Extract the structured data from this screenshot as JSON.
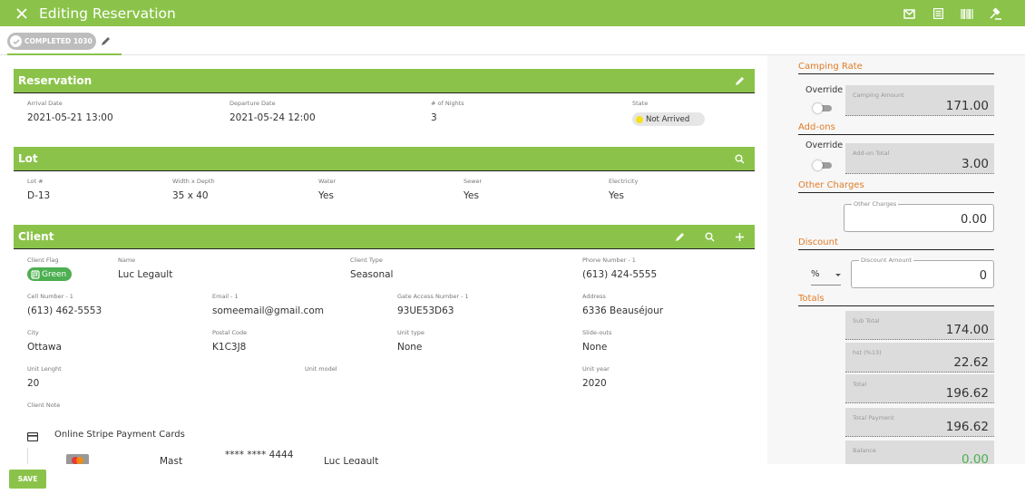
{
  "header": {
    "title": "Editing Reservation"
  },
  "status": {
    "chip": "COMPLETED 1030"
  },
  "reservation": {
    "title": "Reservation",
    "arrival_label": "Arrival Date",
    "arrival": "2021-05-21 13:00",
    "departure_label": "Departure Date",
    "departure": "2021-05-24 12:00",
    "nights_label": "# of Nights",
    "nights": "3",
    "state_label": "State",
    "state": "Not Arrived"
  },
  "lot": {
    "title": "Lot",
    "lot_label": "Lot #",
    "lot": "D-13",
    "size_label": "Width x Depth",
    "size": "35 x 40",
    "water_label": "Water",
    "water": "Yes",
    "sewer_label": "Sewer",
    "sewer": "Yes",
    "elec_label": "Electricity",
    "elec": "Yes"
  },
  "client": {
    "title": "Client",
    "flag_label": "Client Flag",
    "flag": "Green",
    "name_label": "Name",
    "name": "Luc Legault",
    "type_label": "Client Type",
    "type": "Seasonal",
    "phone_label": "Phone Number - 1",
    "phone": "(613) 424-5555",
    "cell_label": "Cell Number - 1",
    "cell": "(613) 462-5553",
    "email_label": "Email - 1",
    "email": "someemail@gmail.com",
    "gate_label": "Gate Access Number - 1",
    "gate": "93UE53D63",
    "address_label": "Address",
    "address": "6336 Beauséjour",
    "city_label": "City",
    "city": "Ottawa",
    "postal_label": "Postal Code",
    "postal": "K1C3J8",
    "unit_type_label": "Unit type",
    "unit_type": "None",
    "slide_label": "Slide-outs",
    "slide": "None",
    "unit_len_label": "Unit Lenght",
    "unit_len": "20",
    "unit_model_label": "Unit model",
    "unit_year_label": "Unit year",
    "unit_year": "2020",
    "note_label": "Client Note",
    "cards_title": "Online Stripe Payment Cards",
    "card_brand": "Mast",
    "card_number": "**** **** 4444",
    "card_holder": "Luc Legault"
  },
  "side": {
    "camping_rate": "Camping Rate",
    "override": "Override",
    "camping_amount_label": "Camping Amount",
    "camping_amount": "171.00",
    "addons": "Add-ons",
    "addon_total_label": "Add-on Total",
    "addon_total": "3.00",
    "other_charges": "Other Charges",
    "other_charges_label": "Other Charges",
    "other_charges_value": "0.00",
    "discount": "Discount",
    "discount_type": "%",
    "discount_amount_label": "Discount Amount",
    "discount_amount": "0",
    "totals": "Totals",
    "subtotal_label": "Sub Total",
    "subtotal": "174.00",
    "hst_label": "hst (%13)",
    "hst": "22.62",
    "total_label": "Total",
    "total": "196.62",
    "payment_label": "Total Payment",
    "payment": "196.62",
    "balance_label": "Balance",
    "balance": "0.00"
  },
  "footer": {
    "save": "SAVE"
  },
  "colors": {
    "accent": "#8bc34a",
    "section": "#e07c27",
    "balance": "#4caf50"
  }
}
